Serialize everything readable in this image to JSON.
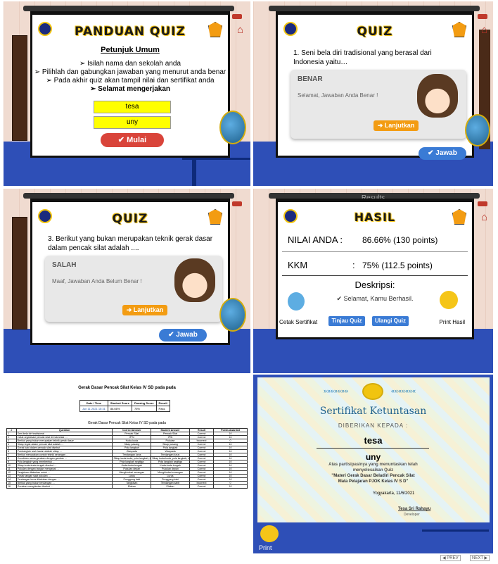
{
  "panel1": {
    "title": "PANDUAN QUIZ",
    "subtitle": "Petunjuk Umum",
    "lines": [
      "➢  Isilah nama dan sekolah anda",
      "➢  Pilihlah dan gabungkan jawaban yang menurut anda benar",
      "➢  Pada akhir quiz akan tampil nilai dan sertifikat anda"
    ],
    "last_line": "➢  Selamat mengerjakan",
    "name_value": "tesa",
    "school_value": "uny",
    "start_label": "✔ Mulai"
  },
  "panel2": {
    "title": "QUIZ",
    "question": "1. Seni bela diri tradisional yang berasal dari Indonesia yaitu…",
    "card_title": "BENAR",
    "card_msg": "Selamat, Jawaban Anda Benar !",
    "continue_label": "➜ Lanjutkan",
    "answer_label": "✔ Jawab"
  },
  "panel3": {
    "title": "QUIZ",
    "question": "3. Berikut yang bukan merupakan teknik gerak dasar dalam pencak silat adalah ....",
    "card_title": "SALAH",
    "card_msg": "Maaf, Jawaban Anda Belum Benar !",
    "continue_label": "➜ Lanjutkan",
    "answer_label": "✔ Jawab"
  },
  "panel4": {
    "header": "Results",
    "title": "HASIL",
    "score_label": "NILAI ANDA :",
    "score_value": "86.66% (130 points)",
    "kkm_label": "KKM",
    "kkm_colon": ":",
    "kkm_value": "75% (112.5 points)",
    "desc_title": "Deskripsi:",
    "desc_text": "✔  Selamat, Kamu Berhasil.",
    "cert_label": "Cetak Sertifikat",
    "review_label": "Tinjau Quiz",
    "retry_label": "Ulangi Quiz",
    "print_label": "Print Hasil"
  },
  "panel5": {
    "title": "Gerak Dasar Pencak Silat Kelas IV SD pada pada",
    "summary_headers": [
      "Date / Time",
      "Student Score",
      "Passing Score",
      "Result"
    ],
    "summary_values": [
      "Jun 11 2021 15:31",
      "86.66%",
      "75%",
      "Pass"
    ],
    "subtitle": "Gerak Dasar Pencak Silat Kelas IV SD pada pada",
    "table_headers": [
      "#",
      "Question",
      "Correct Answer",
      "Student Answer",
      "Result",
      "Points Awarded"
    ],
    "rows": [
      [
        "1",
        "Seni bela diri tradisional …",
        "Pencak Silat",
        "Pencak Silat",
        "Correct",
        "10"
      ],
      [
        "2",
        "Induk organisasi pencak silat di Indonesia …",
        "IPSI",
        "IPSI",
        "Correct",
        "10"
      ],
      [
        "3",
        "Berikut yang bukan merupakan teknik gerak dasar …",
        "Kuda-kuda",
        "Pukulan",
        "Incorrect",
        "0"
      ],
      [
        "4",
        "Sikap tegak dalam pencak silat adalah …",
        "Sikap pasang",
        "Sikap pasang",
        "Correct",
        "10"
      ],
      [
        "5",
        "Gerak kaki dalam pencak silat disebut …",
        "Pola langkah",
        "Pola langkah",
        "Correct",
        "10"
      ],
      [
        "6",
        "Pandanglah arah lawan adalah sikap …",
        "Waspada",
        "Waspada",
        "Correct",
        "10"
      ],
      [
        "7",
        "Berikut merupakan contoh teknik serangan …",
        "Tendangan lurus",
        "Tendangan lurus",
        "Correct",
        "10"
      ],
      [
        "8",
        "Cocokkan nama gerakan dengan gambar …",
        "Sikap kuda-kuda, pola langkah, tangkisan",
        "Sikap kuda-kuda, pola langkah, tangkisan",
        "Correct",
        "10"
      ],
      [
        "9",
        "Pola langkah yang membentuk …",
        "Pola langkah segitiga",
        "Pola langkah segitiga",
        "Correct",
        "10"
      ],
      [
        "10",
        "Sikap kuda-kuda tengah disebut …",
        "Kuda-kuda tengah",
        "Kuda-kuda tengah",
        "Correct",
        "10"
      ],
      [
        "11",
        "Pukulan dengan tangan mengepal …",
        "Pukulan depan",
        "Pukulan depan",
        "Correct",
        "10"
      ],
      [
        "12",
        "Tangkisan dilakukan untuk …",
        "Menghindari serangan",
        "Menghindari serangan",
        "Correct",
        "10"
      ],
      [
        "13",
        "Posisi tangan saat pukulan …",
        "Lurus",
        "Lurus",
        "Correct",
        "10"
      ],
      [
        "14",
        "Tendangan lurus dilakukan dengan …",
        "Punggung kaki",
        "Punggung kaki",
        "Correct",
        "10"
      ],
      [
        "15",
        "Berikut yang bukan tendangan …",
        "Tangkisan",
        "Tendangan sabit",
        "Incorrect",
        "0"
      ],
      [
        "16",
        "Gerakan menghindar disebut …",
        "Elakan",
        "Elakan",
        "Correct",
        "10"
      ]
    ]
  },
  "panel6": {
    "heading": "Sertifikat Ketuntasan",
    "given_to": "DIBERIKAN KEPADA :",
    "name": "tesa",
    "school": "uny",
    "line1": "Atas partisipasinya yang menuntaskan telah",
    "line2": "menyelesaikan Quiz",
    "line3": "\"Materi Gerak Dasar Beladiri Pencak Silat",
    "line4": "Mata Pelajaran PJOK Kelas IV S D\"",
    "place_date": "Yogyakarta,            11/6/2021",
    "signer": "Tesa Sri Rahayu",
    "signer_role": "Developer",
    "print_label": "Print",
    "prev_label": "◀ PREV",
    "next_label": "NEXT ▶"
  }
}
